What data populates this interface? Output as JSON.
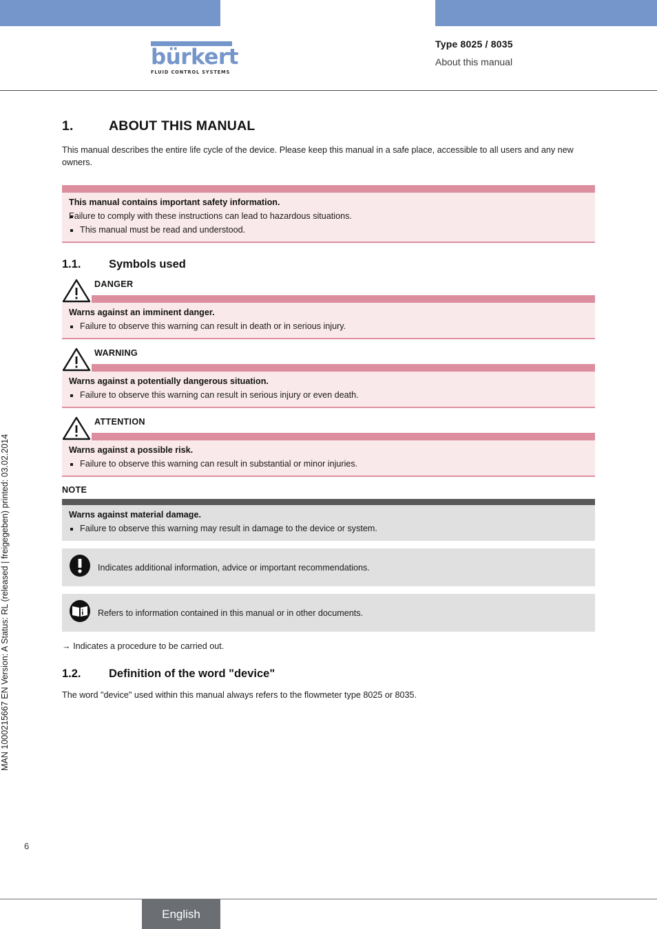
{
  "header": {
    "logo_word": "bürkert",
    "logo_tagline": "FLUID CONTROL SYSTEMS",
    "type_line": "Type 8025 / 8035",
    "subtitle": "About this manual",
    "bar_color": "#7596ca"
  },
  "side_text": "MAN 1000215667  EN  Version: A  Status: RL (released | freigegeben)  printed: 03.02.2014",
  "section": {
    "number": "1.",
    "title": "ABOUT THIS MANUAL",
    "intro": "This manual describes the entire life cycle of the device. Please keep this manual in a safe place, accessible to all users and any new owners."
  },
  "safety_box": {
    "title": "This manual contains important safety information.",
    "line": "Failure to comply with these instructions can lead to hazardous situations.",
    "bullet": "This manual must be read and understood."
  },
  "subsection_1_1": {
    "number": "1.1.",
    "title": "Symbols used"
  },
  "symbols": [
    {
      "icon": "warning-triangle-icon",
      "caption": "DANGER",
      "title": "Warns against an imminent danger.",
      "bullet": "Failure to observe this warning can result in death or in serious injury."
    },
    {
      "icon": "warning-triangle-icon",
      "caption": "WARNING",
      "title": "Warns against a potentially dangerous situation.",
      "bullet": "Failure to observe this warning can result in serious injury or even death."
    },
    {
      "icon": "warning-triangle-icon",
      "caption": "ATTENTION",
      "title": "Warns against a possible risk.",
      "bullet": "Failure to observe this warning can result in substantial or minor injuries."
    }
  ],
  "note": {
    "caption": "NOTE",
    "title": "Warns against material damage.",
    "bullet": "Failure to observe this warning may result in damage to the device or system."
  },
  "info_boxes": [
    {
      "icon": "exclamation-oval-icon",
      "text": "Indicates additional information, advice or important recommendations."
    },
    {
      "icon": "book-info-oval-icon",
      "text": "Refers to information contained in this manual or in other documents."
    }
  ],
  "procedure_line": {
    "arrow": "→",
    "text": "Indicates a procedure to be carried out."
  },
  "subsection_1_2": {
    "number": "1.2.",
    "title": "Definition of the word \"device\"",
    "body": "The word \"device\" used within this manual always refers to the flowmeter type 8025 or 8035."
  },
  "footer": {
    "page_number": "6",
    "language": "English"
  },
  "colors": {
    "accent_blue": "#7596ca",
    "warn_bar_pink": "#dd8e9e",
    "warn_body_pink": "#fae9ea",
    "note_bar_grey": "#595959",
    "note_body_grey": "#e0e0e0",
    "footer_grey": "#6b6e73"
  }
}
